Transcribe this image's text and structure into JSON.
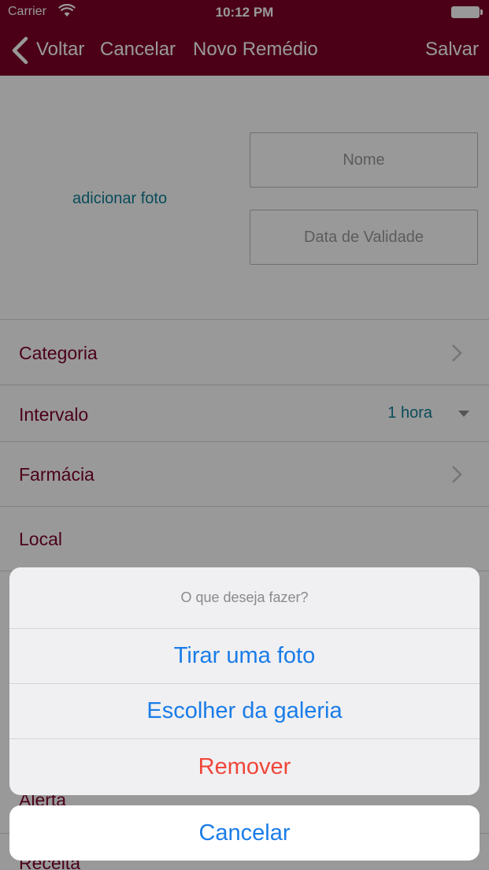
{
  "status_bar": {
    "carrier": "Carrier",
    "time": "10:12 PM"
  },
  "nav": {
    "back_label": "Voltar",
    "cancel_label": "Cancelar",
    "title": "Novo Remédio",
    "save_label": "Salvar"
  },
  "form": {
    "add_photo_label": "adicionar foto",
    "name_placeholder": "Nome",
    "expiry_placeholder": "Data de Validade",
    "rows": [
      {
        "label": "Categoria"
      },
      {
        "label": "Intervalo",
        "value": "1 hora"
      },
      {
        "label": "Farmácia"
      },
      {
        "label": "Local"
      },
      {
        "label": "Alerta"
      },
      {
        "label": "Receita"
      }
    ]
  },
  "action_sheet": {
    "title": "O que deseja fazer?",
    "actions": [
      {
        "label": "Tirar uma foto"
      },
      {
        "label": "Escolher da galeria"
      },
      {
        "label": "Remover"
      }
    ],
    "cancel_label": "Cancelar"
  },
  "colors": {
    "brand": "#7d0029",
    "link": "#0f7f96",
    "action_blue": "#1a7ce8",
    "destructive": "#f0463a"
  }
}
